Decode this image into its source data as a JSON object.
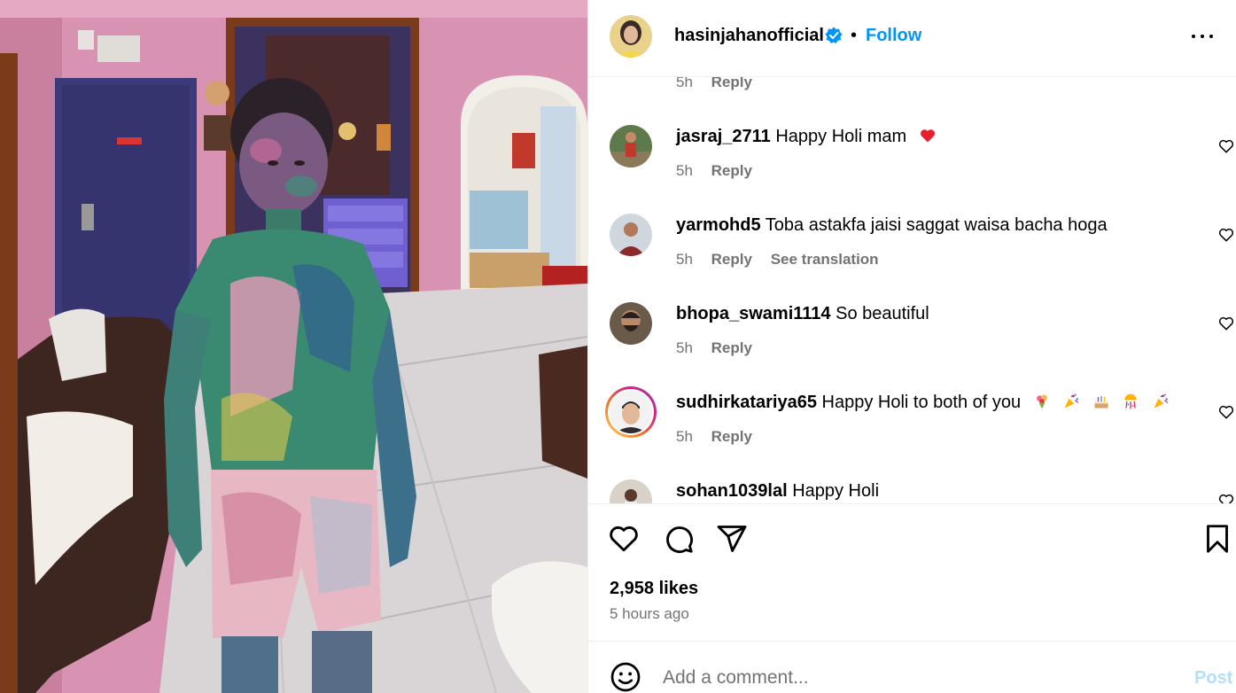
{
  "post": {
    "author": "hasinjahanofficial",
    "separator": "•",
    "follow_label": "Follow",
    "likes": "2,958 likes",
    "time_ago": "5 hours ago"
  },
  "previous_comment": {
    "time": "5h",
    "reply": "Reply"
  },
  "comments": [
    {
      "username": "jasraj_2711",
      "text": "Happy Holi mam",
      "emojis": [
        "red-heart-emoji"
      ],
      "time": "5h",
      "reply": "Reply"
    },
    {
      "username": "yarmohd5",
      "text": "Toba astakfa jaisi saggat waisa bacha hoga",
      "time": "5h",
      "reply": "Reply",
      "translate": "See translation"
    },
    {
      "username": "bhopa_swami1114",
      "text": "So beautiful",
      "time": "5h",
      "reply": "Reply"
    },
    {
      "username": "sudhirkatariya65",
      "text": "Happy Holi to both of you",
      "emojis": [
        "bouquet-emoji",
        "party-popper-emoji",
        "birthday-cake-emoji",
        "confetti-ball-emoji",
        "party-popper-emoji"
      ],
      "time": "5h",
      "reply": "Reply"
    },
    {
      "username": "sohan1039lal",
      "text": "Happy Holi"
    }
  ],
  "composer": {
    "placeholder": "Add a comment...",
    "post_label": "Post"
  },
  "colors": {
    "accent": "#0095f6",
    "secondary_text": "#737373",
    "heart_red": "#ff3040",
    "post_disabled": "#b2dffc"
  }
}
